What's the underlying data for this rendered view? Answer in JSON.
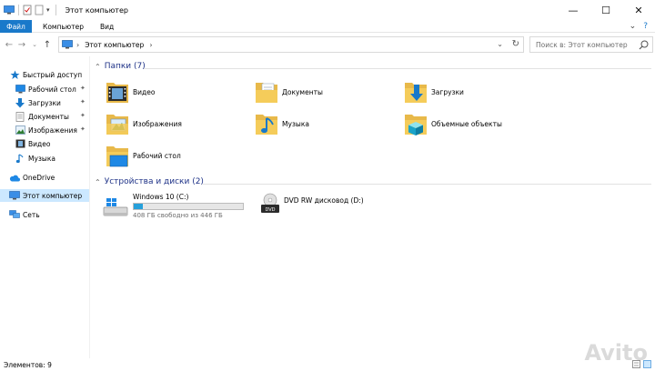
{
  "window": {
    "title": "Этот компьютер",
    "controls": [
      "minimize",
      "maximize",
      "close"
    ]
  },
  "ribbon": {
    "tabs": [
      "Файл",
      "Компьютер",
      "Вид"
    ]
  },
  "address": {
    "path": "Этот компьютер",
    "search_placeholder": "Поиск в: Этот компьютер"
  },
  "sidebar": {
    "quick_access": "Быстрый доступ",
    "items": [
      {
        "label": "Рабочий стол",
        "pinned": true
      },
      {
        "label": "Загрузки",
        "pinned": true
      },
      {
        "label": "Документы",
        "pinned": true
      },
      {
        "label": "Изображения",
        "pinned": true
      },
      {
        "label": "Видео",
        "pinned": false
      },
      {
        "label": "Музыка",
        "pinned": false
      }
    ],
    "onedrive": "OneDrive",
    "this_pc": "Этот компьютер",
    "network": "Сеть"
  },
  "folders_group": {
    "header": "Папки (7)",
    "items": [
      "Видео",
      "Документы",
      "Загрузки",
      "Изображения",
      "Музыка",
      "Объемные объекты",
      "Рабочий стол"
    ]
  },
  "devices_group": {
    "header": "Устройства и диски (2)",
    "drives": [
      {
        "name": "Windows 10 (C:)",
        "free": "408 ГБ свободно из 446 ГБ",
        "used_fraction": 0.085
      },
      {
        "name": "DVD RW дисковод (D:)"
      }
    ]
  },
  "status": {
    "items_count": "Элементов: 9"
  },
  "watermark": "Avito",
  "colors": {
    "accent": "#1979ca",
    "selection": "#cce8ff",
    "group_header": "#1e3287",
    "drive_bar": "#26a0da"
  }
}
